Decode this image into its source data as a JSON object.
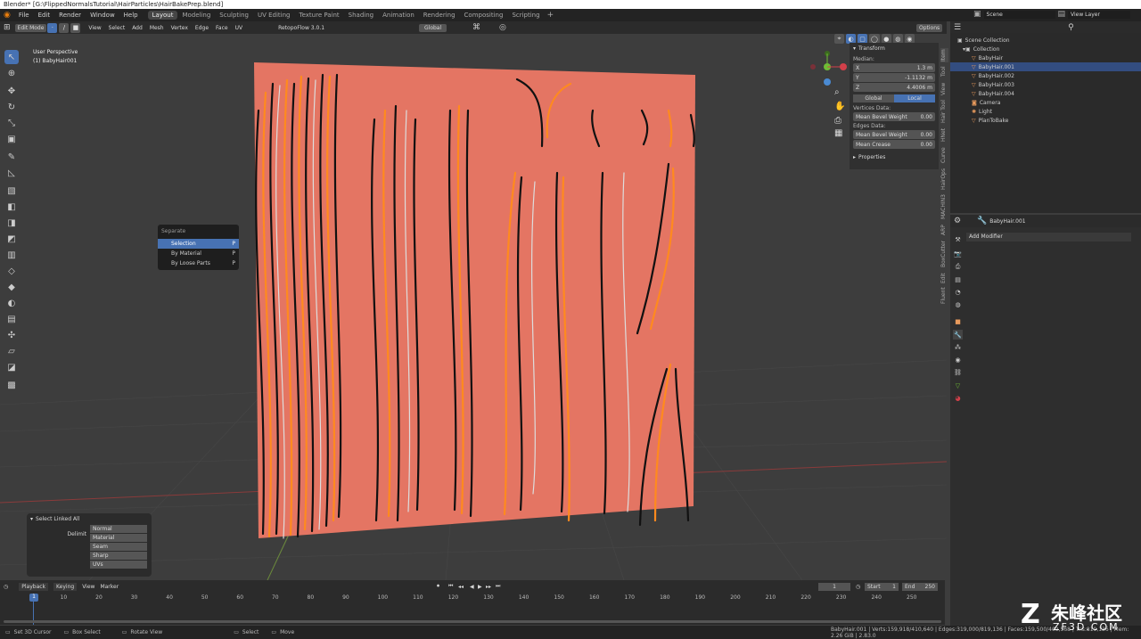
{
  "window": {
    "title": "Blender* [G:\\FlippedNormalsTutorial\\HairParticles\\HairBakePrep.blend]"
  },
  "menu": [
    "File",
    "Edit",
    "Render",
    "Window",
    "Help"
  ],
  "workspaces": [
    "Layout",
    "Modeling",
    "Sculpting",
    "UV Editing",
    "Texture Paint",
    "Shading",
    "Animation",
    "Rendering",
    "Compositing",
    "Scripting"
  ],
  "topright": {
    "scene": "Scene",
    "view_layer": "View Layer"
  },
  "header": {
    "mode": "Edit Mode",
    "menus": [
      "View",
      "Select",
      "Add",
      "Mesh",
      "Vertex",
      "Edge",
      "Face",
      "UV"
    ],
    "addon": "RetopoFlow 3.0.1",
    "orientation": "Global",
    "options": "Options"
  },
  "viewport": {
    "perspective": "User Perspective",
    "object": "(1) BabyHair001"
  },
  "npanel": {
    "section": "Transform",
    "median": "Median:",
    "x_label": "X",
    "x": "1.3 m",
    "y_label": "Y",
    "y": "-1.1132 m",
    "z_label": "Z",
    "z": "4.4006 m",
    "global": "Global",
    "local": "Local",
    "verts_data": "Vertices Data:",
    "mbw_label": "Mean Bevel Weight",
    "mbw": "0.00",
    "edges_data": "Edges Data:",
    "ebw_label": "Mean Bevel Weight",
    "ebw": "0.00",
    "crease_label": "Mean Crease",
    "crease": "0.00",
    "properties": "Properties"
  },
  "vtabs": [
    "Item",
    "Tool",
    "View",
    "Hair Tool",
    "HNet",
    "Curve",
    "HairOps",
    "MACHIN3",
    "ARP",
    "BoxCutter",
    "Edit",
    "Fluent"
  ],
  "outliner": {
    "root": "Scene Collection",
    "collection": "Collection",
    "items": [
      "BabyHair",
      "BabyHair.001",
      "BabyHair.002",
      "BabyHair.003",
      "BabyHair.004",
      "Camera",
      "Light",
      "PlanToBake"
    ]
  },
  "properties": {
    "object": "BabyHair.001",
    "add_modifier": "Add Modifier"
  },
  "popup": {
    "title": "Separate",
    "items": [
      "Selection",
      "By Material",
      "By Loose Parts"
    ]
  },
  "lastop": {
    "title": "Select Linked All",
    "delimit_label": "Delimit",
    "options": [
      "Normal",
      "Material",
      "Seam",
      "Sharp",
      "UVs"
    ]
  },
  "timeline": {
    "menus": [
      "Playback",
      "Keying",
      "View",
      "Marker"
    ],
    "current": "1",
    "start_label": "Start",
    "start": "1",
    "end_label": "End",
    "end": "250",
    "ticks": [
      "1",
      "10",
      "20",
      "30",
      "40",
      "50",
      "60",
      "70",
      "80",
      "90",
      "100",
      "110",
      "120",
      "130",
      "140",
      "150",
      "160",
      "170",
      "180",
      "190",
      "200",
      "210",
      "220",
      "230",
      "240",
      "250"
    ]
  },
  "status": {
    "set_cursor": "Set 3D Cursor",
    "box_select": "Box Select",
    "rotate": "Rotate View",
    "select": "Select",
    "move": "Move",
    "info": "BabyHair.001 | Verts:159,918/410,640 | Edges:319,000/819,136 | Faces:159,500/409,568 | Tris:819,136 | Mem: 2.26 GiB | 2.83.0"
  },
  "watermark": {
    "cn": "朱峰社区",
    "url": "ZF3D.COM"
  }
}
